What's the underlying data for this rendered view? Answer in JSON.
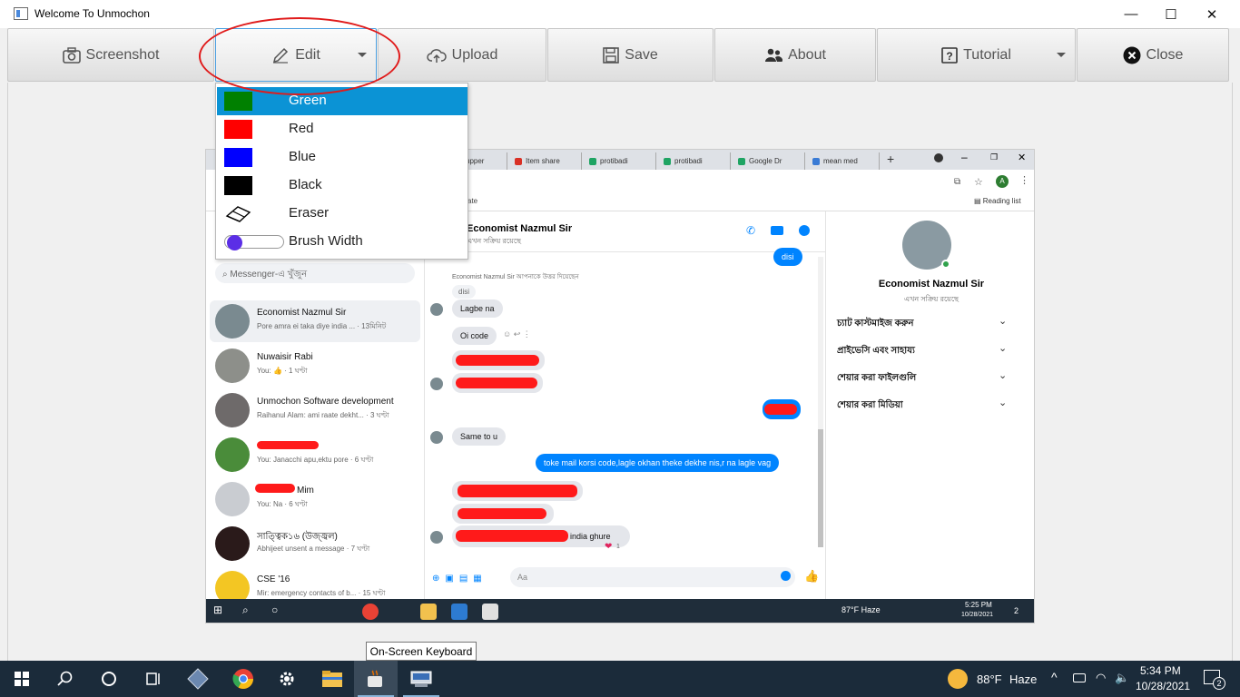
{
  "window": {
    "title": "Welcome To Unmochon",
    "controls": {
      "minimize": "—",
      "maximize": "☐",
      "close": "✕"
    }
  },
  "toolbar": {
    "screenshot": "Screenshot",
    "edit": "Edit",
    "upload": "Upload",
    "save": "Save",
    "about": "About",
    "tutorial": "Tutorial",
    "close": "Close"
  },
  "edit_menu": {
    "items": [
      {
        "label": "Green",
        "color": "#008000",
        "selected": true
      },
      {
        "label": "Red",
        "color": "#ff0000"
      },
      {
        "label": "Blue",
        "color": "#0000ff"
      },
      {
        "label": "Black",
        "color": "#000000"
      },
      {
        "label": "Eraser",
        "icon": "eraser-icon"
      },
      {
        "label": "Brush Width",
        "icon": "slider-icon",
        "slider_accent": "#5b2ee6"
      }
    ]
  },
  "tooltip": "On-Screen Keyboard",
  "screenshot_content": {
    "browser_tabs": [
      "upper",
      "Item share",
      "protibadi",
      "protibadi",
      "Google Dr",
      "mean med"
    ],
    "reading_list": "Reading list",
    "addr_partial": "ate",
    "search_placeholder": "Messenger-এ খুঁজুন",
    "conversations": [
      {
        "name": "Economist Nazmul Sir",
        "sub": "Pore amra ei taka diye india ... · 13মিনিট"
      },
      {
        "name": "Nuwaisir Rabi",
        "sub": "You: 👍 · 1 ঘণ্টা"
      },
      {
        "name": "Unmochon Software development",
        "sub": "Raihanul Alam: ami raate dekht... · 3 ঘণ্টা"
      },
      {
        "name": "",
        "sub": "You: Janacchi apu,ektu pore · 6 ঘণ্টা"
      },
      {
        "name": "Mim",
        "sub": "You: Na · 6 ঘণ্টা"
      },
      {
        "name": "সাত্ত্বিক১৬ (উজ্জ্বল)",
        "sub": "Abhijeet unsent a message · 7 ঘণ্টা"
      },
      {
        "name": "CSE '16",
        "sub": "Mir: emergency contacts of b... · 15 ঘণ্টা"
      }
    ],
    "chat_header": {
      "name": "Economist Nazmul Sir",
      "status": "এখন সক্রিয় রয়েছে"
    },
    "reply_note": "Economist Nazmul Sir আপনাকে উত্তর দিয়েছেন",
    "messages": {
      "disi_out": "disi",
      "disi_quote": "disi",
      "lagbe": "Lagbe na",
      "oi_code": "Oi code",
      "same": "Same to u",
      "toke": "toke mail korsi code,lagle okhan theke dekhe nis,r na lagle vag",
      "india": "india ghure",
      "reaction_count": "1"
    },
    "composer_placeholder": "Aa",
    "right_panel": {
      "name": "Economist Nazmul Sir",
      "status": "এখন সক্রিয় রয়েছে",
      "sections": [
        "চ্যাট কাস্টমাইজ করুন",
        "প্রাইভেসি এবং সাহায্য",
        "শেয়ার করা ফাইলগুলি",
        "শেয়ার করা মিডিয়া"
      ]
    },
    "inner_taskbar": {
      "weather": "87°F  Haze",
      "time": "5:25 PM",
      "date": "10/28/2021",
      "notif": "2"
    }
  },
  "taskbar": {
    "weather_temp": "88°F",
    "weather_desc": "Haze",
    "time": "5:34 PM",
    "date": "10/28/2021",
    "notifications": "2"
  }
}
